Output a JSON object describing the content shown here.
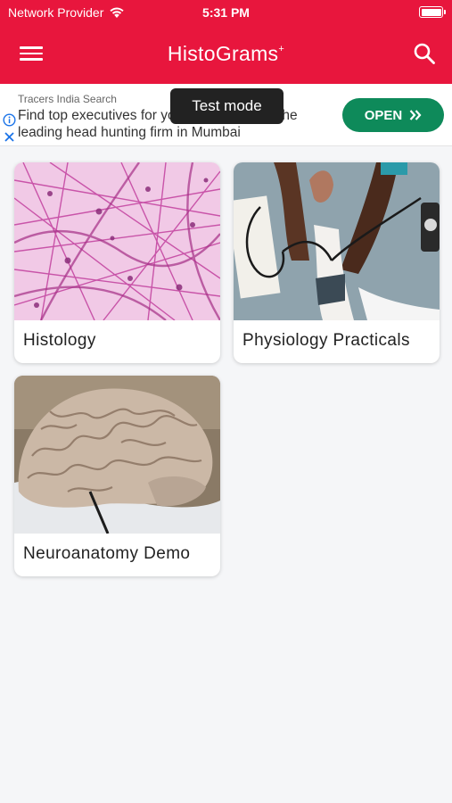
{
  "status_bar": {
    "carrier": "Network Provider",
    "time": "5:31 PM"
  },
  "app_bar": {
    "title": "HistoGrams",
    "title_mark": "+"
  },
  "ad": {
    "sponsor": "Tracers India Search",
    "headline": "Find top executives for your business with the leading head hunting firm in Mumbai",
    "cta": "OPEN",
    "test_mode": "Test mode"
  },
  "categories": [
    {
      "label": "Histology",
      "image": "histology-tissue-photo"
    },
    {
      "label": "Physiology Practicals",
      "image": "blood-pressure-measurement-photo"
    },
    {
      "label": "Neuroanatomy Demo",
      "image": "brain-model-photo"
    }
  ],
  "colors": {
    "brand": "#e8163d",
    "cta": "#0e8a5a",
    "background": "#f5f6f8"
  }
}
